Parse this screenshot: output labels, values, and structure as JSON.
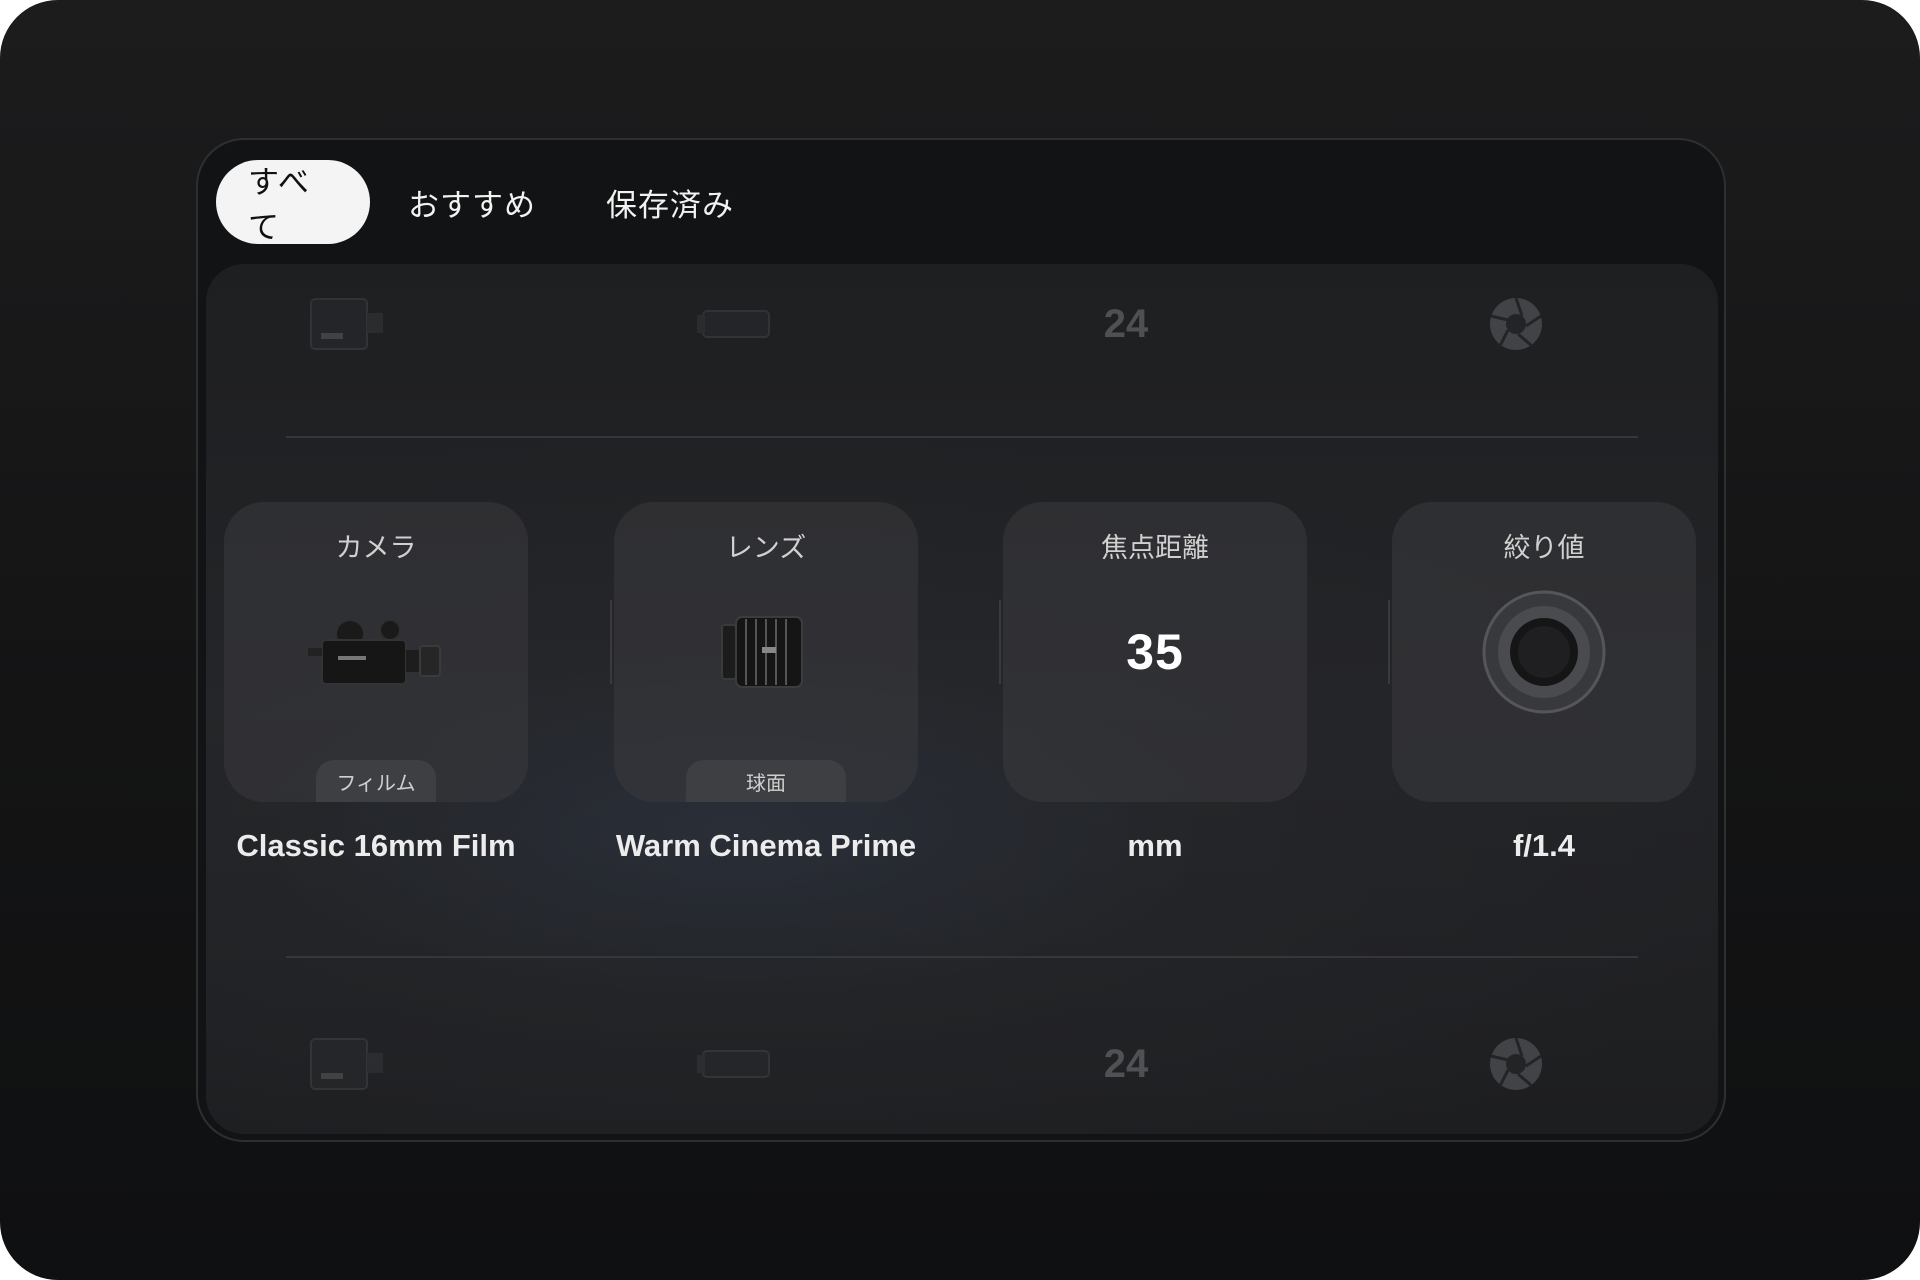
{
  "tabs": [
    {
      "label": "すべて",
      "active": true
    },
    {
      "label": "おすすめ",
      "active": false
    },
    {
      "label": "保存済み",
      "active": false
    }
  ],
  "ghost_row": {
    "items": [
      {
        "kind": "camera-icon"
      },
      {
        "kind": "lens-icon"
      },
      {
        "kind": "number",
        "text": "24"
      },
      {
        "kind": "aperture-icon"
      }
    ]
  },
  "cards": [
    {
      "label": "カメラ",
      "visual": "film-camera-icon",
      "badge": "フィルム",
      "value": "Classic 16mm Film"
    },
    {
      "label": "レンズ",
      "visual": "cinema-lens-icon",
      "badge": "球面",
      "value": "Warm Cinema Prime"
    },
    {
      "label": "焦点距離",
      "visual_text": "35",
      "value": "mm"
    },
    {
      "label": "絞り値",
      "visual": "aperture-ring-icon",
      "value": "f/1.4"
    }
  ],
  "colors": {
    "background": "#141415",
    "panel": "#121314",
    "active_tab": "#f4f4f4",
    "card": "#3a3b3e"
  }
}
